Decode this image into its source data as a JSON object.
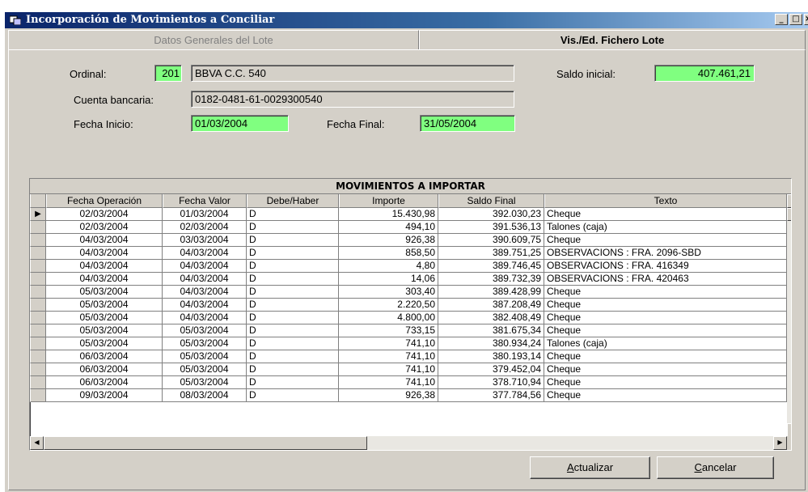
{
  "window": {
    "title": "Incorporación de Movimientos a Conciliar"
  },
  "tabs": [
    {
      "label": "Datos Generales del Lote",
      "active": false
    },
    {
      "label": "Vis./Ed. Fichero Lote",
      "active": true
    }
  ],
  "form": {
    "ordinal_label": "Ordinal:",
    "ordinal_value": "201",
    "bank_name": "BBVA C.C. 540",
    "saldo_label": "Saldo inicial:",
    "saldo_value": "407.461,21",
    "cuenta_label": "Cuenta bancaria:",
    "cuenta_value": "0182-0481-61-0029300540",
    "fecha_inicio_label": "Fecha Inicio:",
    "fecha_inicio_value": "01/03/2004",
    "fecha_final_label": "Fecha Final:",
    "fecha_final_value": "31/05/2004"
  },
  "grid": {
    "title": "MOVIMIENTOS A IMPORTAR",
    "columns": [
      "Fecha Operación",
      "Fecha Valor",
      "Debe/Haber",
      "Importe",
      "Saldo Final",
      "Texto"
    ],
    "rows": [
      [
        "02/03/2004",
        "01/03/2004",
        "D",
        "15.430,98",
        "392.030,23",
        "Cheque"
      ],
      [
        "02/03/2004",
        "02/03/2004",
        "D",
        "494,10",
        "391.536,13",
        "Talones (caja)"
      ],
      [
        "04/03/2004",
        "03/03/2004",
        "D",
        "926,38",
        "390.609,75",
        "Cheque"
      ],
      [
        "04/03/2004",
        "04/03/2004",
        "D",
        "858,50",
        "389.751,25",
        "OBSERVACIONS  : FRA. 2096-SBD"
      ],
      [
        "04/03/2004",
        "04/03/2004",
        "D",
        "4,80",
        "389.746,45",
        "OBSERVACIONS  : FRA. 416349"
      ],
      [
        "04/03/2004",
        "04/03/2004",
        "D",
        "14,06",
        "389.732,39",
        "OBSERVACIONS  : FRA. 420463"
      ],
      [
        "05/03/2004",
        "04/03/2004",
        "D",
        "303,40",
        "389.428,99",
        "Cheque"
      ],
      [
        "05/03/2004",
        "04/03/2004",
        "D",
        "2.220,50",
        "387.208,49",
        "Cheque"
      ],
      [
        "05/03/2004",
        "04/03/2004",
        "D",
        "4.800,00",
        "382.408,49",
        "Cheque"
      ],
      [
        "05/03/2004",
        "05/03/2004",
        "D",
        "733,15",
        "381.675,34",
        "Cheque"
      ],
      [
        "05/03/2004",
        "05/03/2004",
        "D",
        "741,10",
        "380.934,24",
        "Talones (caja)"
      ],
      [
        "06/03/2004",
        "05/03/2004",
        "D",
        "741,10",
        "380.193,14",
        "Cheque"
      ],
      [
        "06/03/2004",
        "05/03/2004",
        "D",
        "741,10",
        "379.452,04",
        "Cheque"
      ],
      [
        "06/03/2004",
        "05/03/2004",
        "D",
        "741,10",
        "378.710,94",
        "Cheque"
      ],
      [
        "09/03/2004",
        "08/03/2004",
        "D",
        "926,38",
        "377.784,56",
        "Cheque"
      ]
    ]
  },
  "buttons": {
    "actualizar": "Actualizar",
    "cancelar": "Cancelar"
  },
  "colors": {
    "field_green": "#80ff80",
    "title_bar": "#0a246a",
    "face": "#d4d0c8"
  }
}
